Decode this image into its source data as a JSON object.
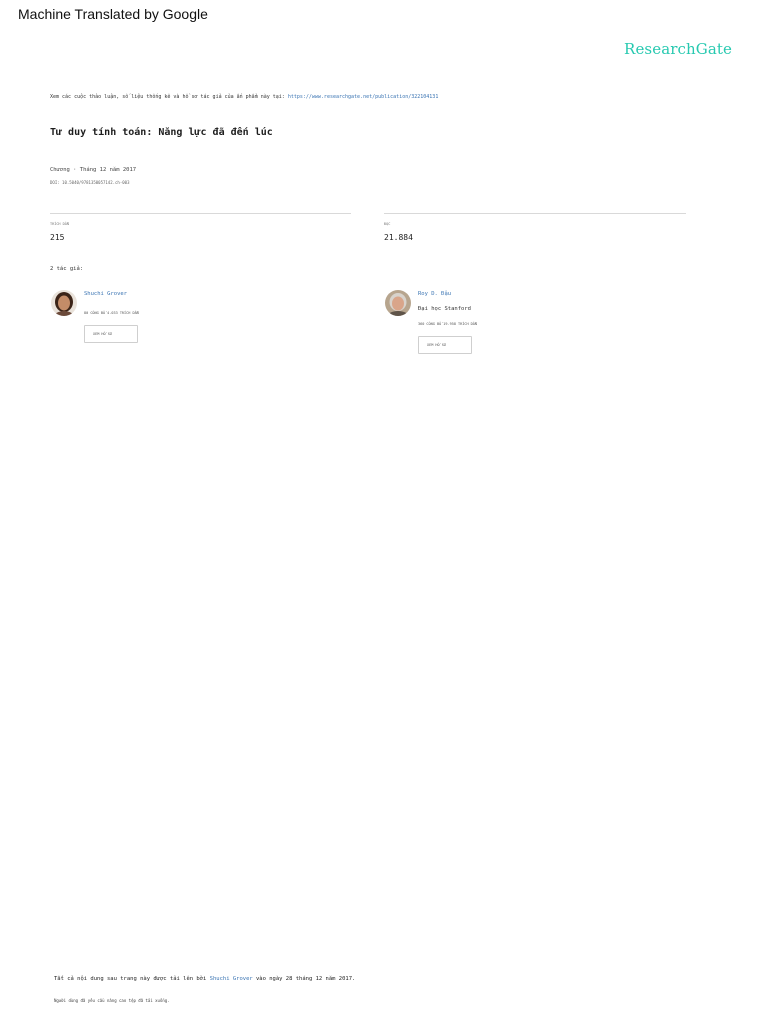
{
  "banner": "Machine Translated by Google",
  "brand": "ResearchGate",
  "intro": {
    "text": "Xem các cuộc thảo luận, số liệu thống kê và hồ sơ tác giả của ấn phẩm này tại: ",
    "link": "https://www.researchgate.net/publication/322104131"
  },
  "title": "Tư duy tính toán: Năng lực đã đến lúc",
  "meta": "Chương · Tháng 12 năm 2017",
  "doi": "DOI: 10.5040/9781350057142.ch-003",
  "stats": [
    {
      "label": "TRÍCH DẪN",
      "value": "215"
    },
    {
      "label": "ĐỌC",
      "value": "21.884"
    }
  ],
  "authors_label": "2 tác giả:",
  "authors": [
    {
      "name": "Shuchi Grover",
      "institution": "",
      "stats": "80 CÔNG BỐ 4.033 TRÍCH DẪN",
      "button": "XEM HỒ SƠ"
    },
    {
      "name": "Roy D. Đậu",
      "institution": "Đại học Stanford",
      "stats": "360 CÔNG BỐ 19.958 TRÍCH DẪN",
      "button": "XEM HỒ SƠ"
    }
  ],
  "footer": {
    "before": "Tất cả nội dung sau trang này được tải lên bởi ",
    "author": "Shuchi Grover",
    "after": " vào ngày 28 tháng 12 năm 2017.",
    "note": "Người dùng đã yêu cầu nâng cao tệp đã tải xuống."
  },
  "colors": {
    "brand": "#27c9b0",
    "link": "#3a74b3"
  },
  "icons": [
    "avatar-shuchi-grover",
    "avatar-roy-pea"
  ]
}
